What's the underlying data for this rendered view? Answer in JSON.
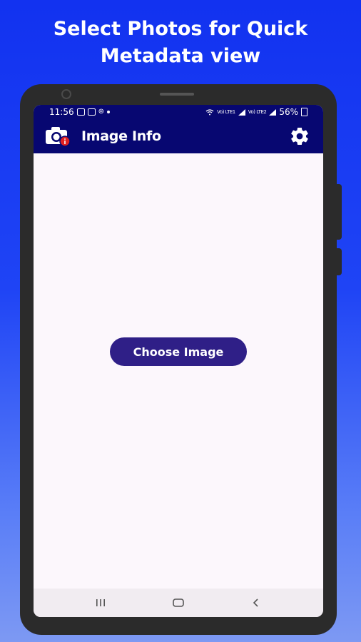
{
  "promo": {
    "line1": "Select Photos for Quick",
    "line2": "Metadata view"
  },
  "status_bar": {
    "time": "11:56",
    "battery": "56%",
    "network_label": "Vo) LTE1",
    "network_label_2": "Vo) LTE2"
  },
  "app_bar": {
    "title": "Image Info",
    "logo_icon": "camera-info-icon",
    "settings_icon": "gear-icon"
  },
  "main": {
    "choose_button_label": "Choose Image"
  },
  "nav_bar": {
    "recents_icon": "recents-icon",
    "home_icon": "home-icon",
    "back_icon": "back-icon"
  },
  "colors": {
    "app_bar": "#070771",
    "button": "#2f1f87",
    "screen_bg": "#fcf7fc",
    "promo_bg": "#1232f0"
  }
}
